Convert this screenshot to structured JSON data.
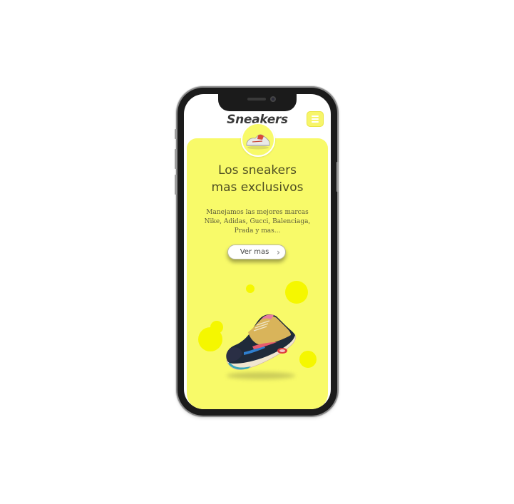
{
  "header": {
    "brand": "Sneakers",
    "menu_icon": "hamburger-menu-icon"
  },
  "hero": {
    "headline_line1": "Los sneakers",
    "headline_line2": "mas exclusivos",
    "description": "Manejamos las mejores marcas Nike, Adidas, Gucci, Balenciaga, Prada y mas...",
    "cta_label": "Ver mas",
    "cta_icon": "chevron-right-icon"
  },
  "colors": {
    "accent": "#f8fa69",
    "bubble": "#f5f700",
    "text": "#4e4e22"
  }
}
